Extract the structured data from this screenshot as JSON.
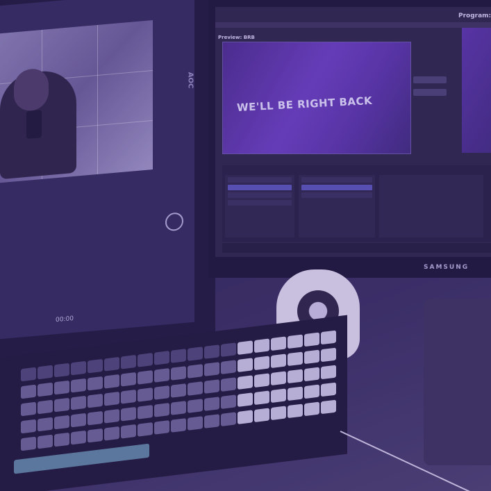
{
  "left_monitor": {
    "timer_text": "00:00"
  },
  "right_monitor": {
    "brand": "AOC",
    "obs": {
      "program_label": "Program: DEF",
      "preview_label": "Preview: BRB",
      "preview_text": "WE'LL BE RIGHT BACK"
    }
  },
  "samsung": {
    "brand": "SAMSUNG"
  }
}
